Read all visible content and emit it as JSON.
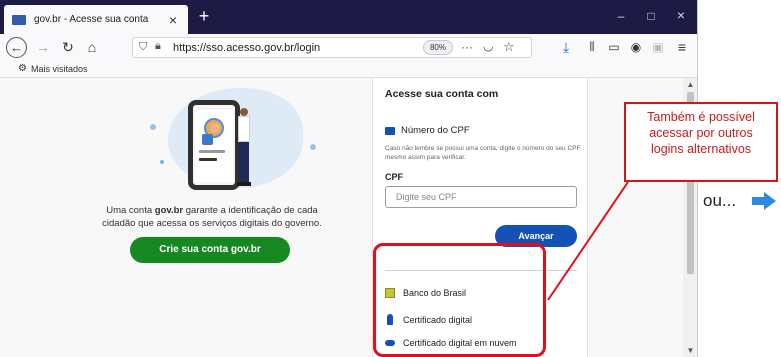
{
  "browser": {
    "tab_title": "gov.br - Acesse sua conta",
    "tab_close": "×",
    "new_tab": "+",
    "window_controls": {
      "minimize": "–",
      "maximize": "□",
      "close": "×"
    },
    "url": "https://sso.acesso.gov.br/login",
    "zoom": "80%",
    "url_more": "···",
    "bookmark": "Mais visitados"
  },
  "left": {
    "description_pre": "Uma conta ",
    "description_brand": "gov.br",
    "description_post": " garante a identificação de cada cidadão que acessa os serviços digitais do governo.",
    "create_button": "Crie sua conta gov.br"
  },
  "panel": {
    "title": "Acesse sua conta com",
    "cpf_option": "Número do CPF",
    "cpf_help": "Caso não lembre se possui uma conta, digite o número do seu CPF mesmo assim para verificar.",
    "cpf_label": "CPF",
    "cpf_placeholder": "Digite seu CPF",
    "advance_button": "Avançar",
    "alternatives": [
      {
        "label": "Banco do Brasil",
        "icon": "bank-icon"
      },
      {
        "label": "Certificado digital",
        "icon": "usb-token-icon"
      },
      {
        "label": "Certificado digital em nuvem",
        "icon": "cloud-icon"
      }
    ]
  },
  "annotation": {
    "callout_lines": [
      "Também é possível",
      "acessar por outros",
      "logins alternativos"
    ],
    "ou": "ou..."
  },
  "colors": {
    "tab_bar": "#1d1a45",
    "primary_blue": "#1351b4",
    "green_button": "#168821",
    "annotation_red": "#e0101a",
    "arrow_blue": "#2b8be0"
  }
}
